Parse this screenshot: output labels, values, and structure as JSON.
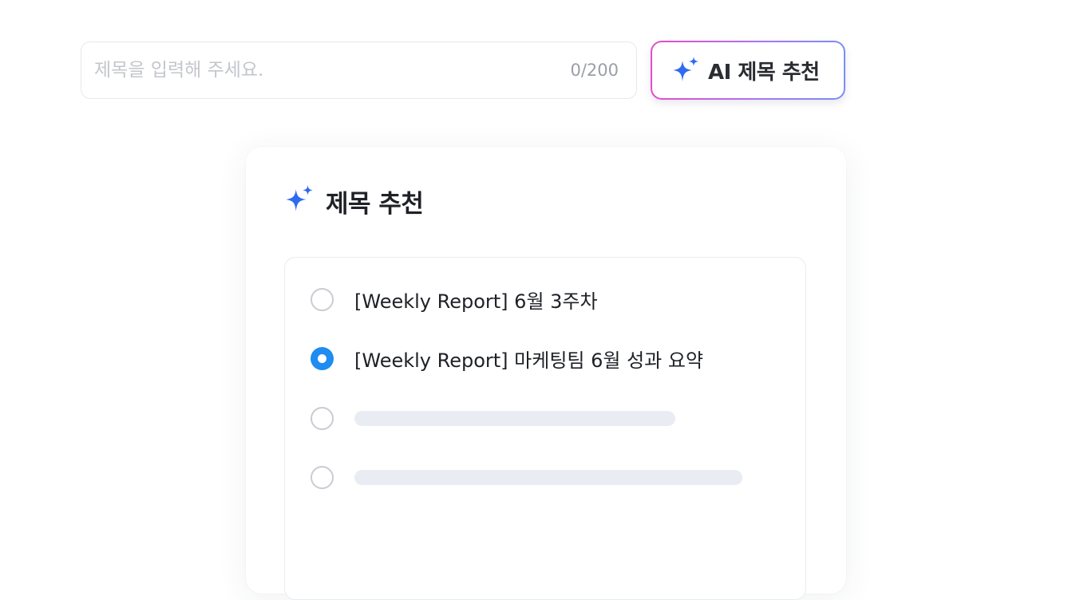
{
  "title_field": {
    "placeholder": "제목을 입력해 주세요.",
    "value": "",
    "char_count": "0/200"
  },
  "ai_button": {
    "label": "AI 제목 추천",
    "icon": "sparkle-icon",
    "gradient_colors": [
      "#e54bc8",
      "#7b8cf7"
    ]
  },
  "suggestion_panel": {
    "title": "제목 추천",
    "icon": "sparkle-icon",
    "accent_color": "#2f6bf0",
    "options": [
      {
        "label": "[Weekly Report] 6월 3주차",
        "selected": false,
        "loading": false
      },
      {
        "label": "[Weekly Report] 마케팅팀 6월 성과 요약",
        "selected": true,
        "loading": false
      },
      {
        "label": "",
        "selected": false,
        "loading": true
      },
      {
        "label": "",
        "selected": false,
        "loading": true
      }
    ]
  },
  "colors": {
    "radio_selected": "#1e8cf0",
    "skeleton": "#e9ecf2"
  }
}
